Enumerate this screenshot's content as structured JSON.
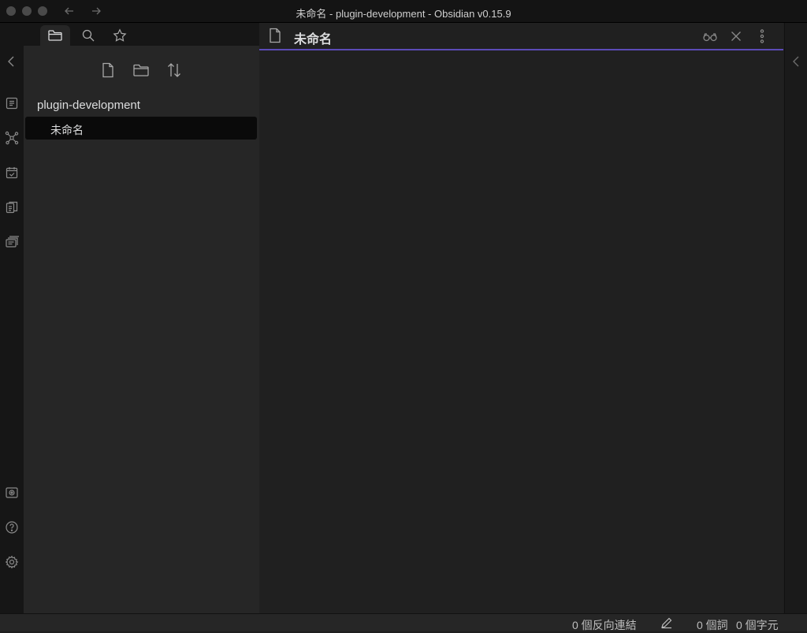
{
  "window": {
    "title": "未命名 - plugin-development - Obsidian v0.15.9"
  },
  "ribbon": {
    "icons": [
      "collapse-left-icon",
      "open-quick-switcher-icon",
      "graph-view-icon",
      "daily-note-icon",
      "templates-icon",
      "slides-icon",
      "vault-switcher-icon",
      "help-icon",
      "settings-icon"
    ]
  },
  "left_sidebar": {
    "tabs": [
      "file-explorer-tab",
      "search-tab",
      "bookmarks-tab"
    ],
    "toolbar": [
      "new-note",
      "new-folder",
      "sort-order"
    ],
    "vault_name": "plugin-development",
    "files": [
      {
        "name": "未命名",
        "active": true
      }
    ]
  },
  "editor": {
    "title": "未命名",
    "accent": "#5b4bb7"
  },
  "statusbar": {
    "backlinks": "0 個反向連結",
    "words": "0 個詞",
    "chars": "0 個字元"
  }
}
